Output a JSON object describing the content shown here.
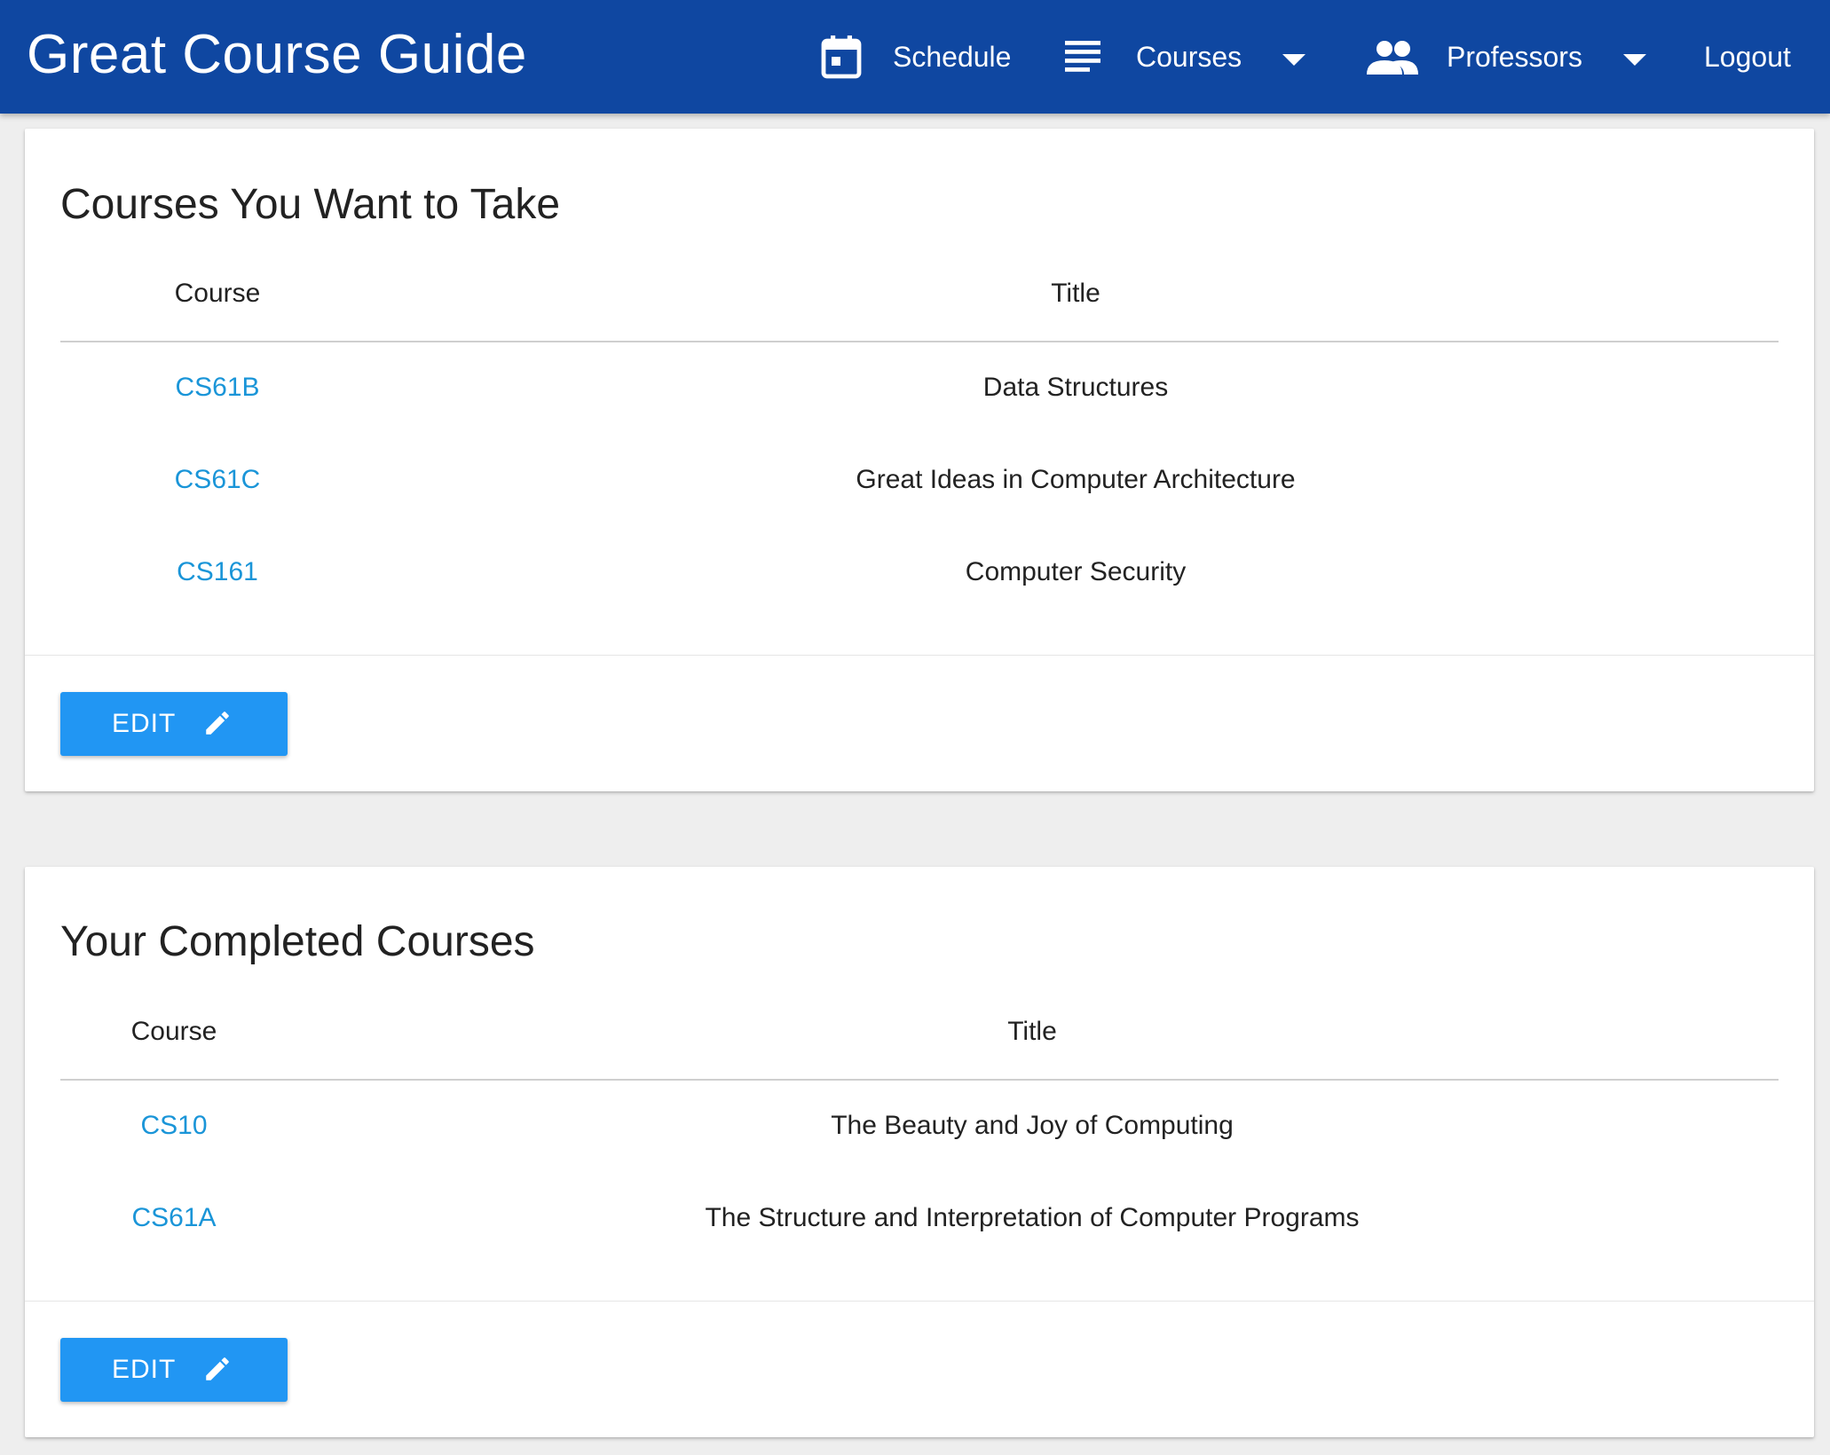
{
  "header": {
    "brand": "Great Course Guide",
    "nav": {
      "schedule": {
        "label": "Schedule",
        "icon": "calendar-icon"
      },
      "courses": {
        "label": "Courses",
        "icon": "list-icon"
      },
      "professors": {
        "label": "Professors",
        "icon": "people-icon"
      },
      "logout": {
        "label": "Logout"
      }
    },
    "background_color": "#0f47a1"
  },
  "want_to_take": {
    "title": "Courses You Want to Take",
    "columns": {
      "course": "Course",
      "title": "Title"
    },
    "rows": [
      {
        "course": "CS61B",
        "title": "Data Structures"
      },
      {
        "course": "CS61C",
        "title": "Great Ideas in Computer Architecture"
      },
      {
        "course": "CS161",
        "title": "Computer Security"
      }
    ],
    "edit_label": "EDIT"
  },
  "completed": {
    "title": "Your Completed Courses",
    "columns": {
      "course": "Course",
      "title": "Title"
    },
    "rows": [
      {
        "course": "CS10",
        "title": "The Beauty and Joy of Computing"
      },
      {
        "course": "CS61A",
        "title": "The Structure and Interpretation of Computer Programs"
      }
    ],
    "edit_label": "EDIT"
  },
  "colors": {
    "link": "#1a95d8",
    "button": "#2196f3",
    "page_background": "#eeeeee"
  }
}
